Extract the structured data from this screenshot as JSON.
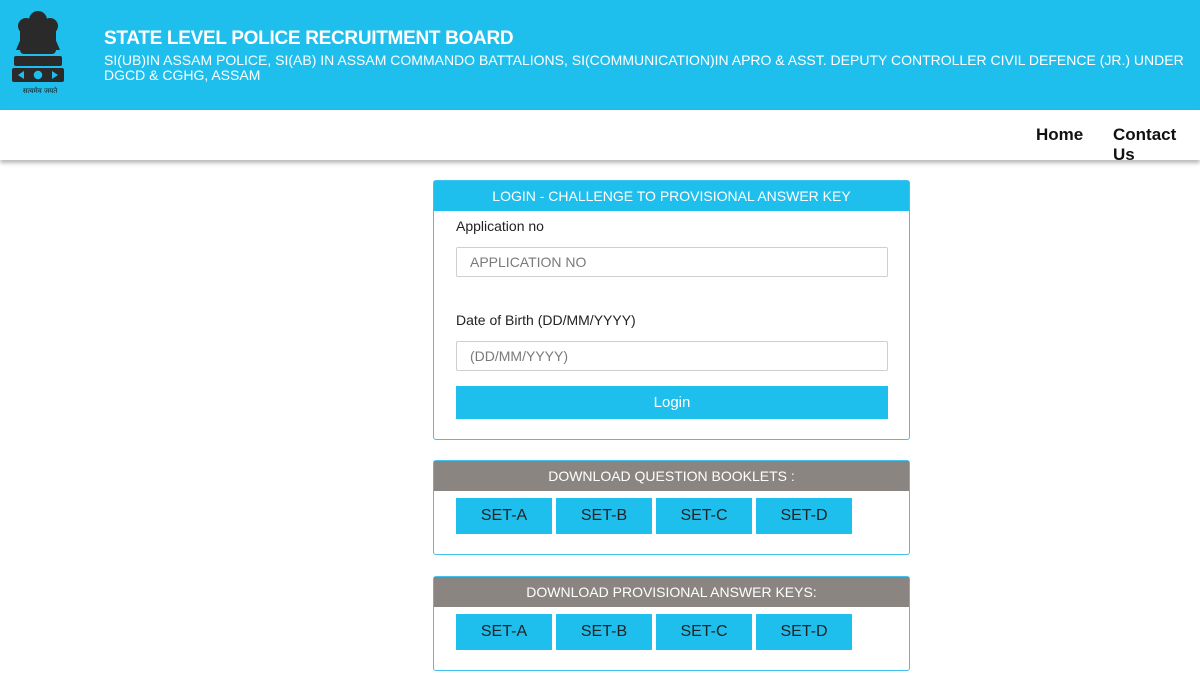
{
  "header": {
    "emblem_icon": "national-emblem-icon",
    "motto": "सत्यमेव जयते",
    "title": "STATE LEVEL POLICE RECRUITMENT BOARD",
    "subtitle": "SI(UB)IN ASSAM POLICE, SI(AB) IN ASSAM COMMANDO BATTALIONS, SI(COMMUNICATION)IN APRO & ASST. DEPUTY CONTROLLER CIVIL DEFENCE (JR.) UNDER DGCD & CGHG, ASSAM",
    "accent_color": "#1fbfed"
  },
  "nav": {
    "home": "Home",
    "contact": "Contact Us"
  },
  "login": {
    "title": "LOGIN - CHALLENGE TO PROVISIONAL ANSWER KEY",
    "application_label": "Application no",
    "application_placeholder": "APPLICATION NO",
    "application_value": "",
    "dob_label": "Date of Birth (DD/MM/YYYY)",
    "dob_placeholder": "(DD/MM/YYYY)",
    "dob_value": "",
    "button": "Login"
  },
  "question_booklets": {
    "title": "DOWNLOAD QUESTION BOOKLETS :",
    "sets": [
      "SET-A",
      "SET-B",
      "SET-C",
      "SET-D"
    ]
  },
  "answer_keys": {
    "title": "DOWNLOAD PROVISIONAL ANSWER KEYS:",
    "sets": [
      "SET-A",
      "SET-B",
      "SET-C",
      "SET-D"
    ]
  }
}
